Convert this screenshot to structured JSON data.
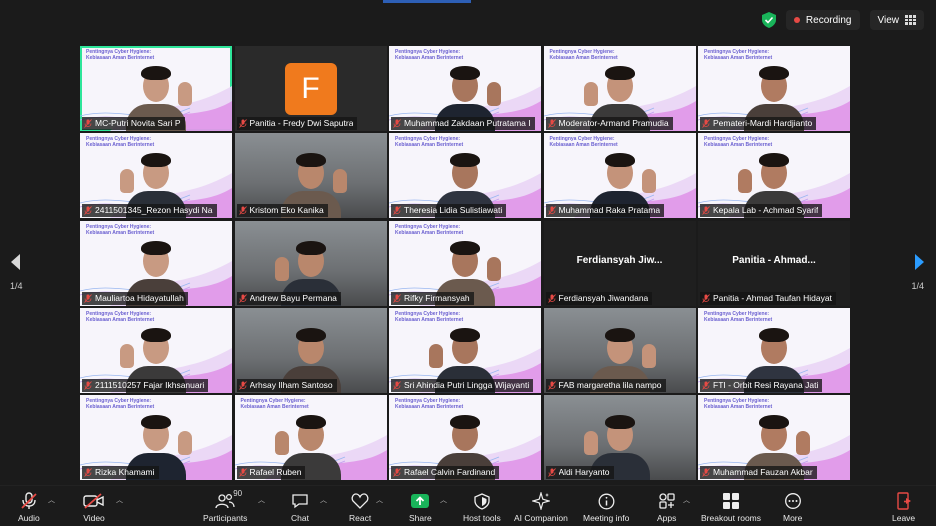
{
  "header": {
    "recording_label": "Recording",
    "view_label": "View"
  },
  "colors": {
    "background": "#1b1b1b",
    "active_speaker": "#2ee59a",
    "recording": "#e74a45",
    "share": "#19b45a",
    "avatar": "#f07a1d",
    "nav_arrow": "#2b9cff"
  },
  "slide": {
    "line1": "Pentingnya Cyber Hygiene:",
    "line2": "Kebiasaan Aman Berinternet"
  },
  "pagination": {
    "left": "1/4",
    "right": "1/4"
  },
  "tiles": [
    {
      "name": "MC-Putri Novita Sari P",
      "kind": "slide",
      "active": true
    },
    {
      "name": "Panitia - Fredy Dwi Saputra",
      "kind": "avatar",
      "avatar_letter": "F"
    },
    {
      "name": "Muhammad Zakdaan Putratama I",
      "kind": "slide"
    },
    {
      "name": "Moderator-Armand Pramudia",
      "kind": "slide"
    },
    {
      "name": "Pemateri-Mardi Hardjianto",
      "kind": "slide"
    },
    {
      "name": "2411501345_Rezon Hasydi Na",
      "kind": "slide"
    },
    {
      "name": "Kristom Eko Kanika",
      "kind": "room"
    },
    {
      "name": "Theresia Lidia Sulistiawati",
      "kind": "slide"
    },
    {
      "name": "Muhammad Raka Pratama",
      "kind": "slide"
    },
    {
      "name": "Kepala Lab - Achmad Syarif",
      "kind": "slide"
    },
    {
      "name": "Mauliartoa Hidayatullah",
      "kind": "slide"
    },
    {
      "name": "Andrew Bayu Permana",
      "kind": "room"
    },
    {
      "name": "Rifky Firmansyah",
      "kind": "slide"
    },
    {
      "name": "Ferdiansyah Jiwandana",
      "kind": "off",
      "display_name": "Ferdiansyah  Jiw..."
    },
    {
      "name": "Panitia - Ahmad Taufan Hidayat",
      "kind": "off",
      "display_name": "Panitia  -  Ahmad..."
    },
    {
      "name": "2111510257 Fajar Ikhsanuari",
      "kind": "slide"
    },
    {
      "name": "Arhsay Ilham Santoso",
      "kind": "room"
    },
    {
      "name": "Sri Ahindia Putri Lingga Wijayanti",
      "kind": "slide"
    },
    {
      "name": "FAB margaretha lila nampo",
      "kind": "room"
    },
    {
      "name": "FTI - Orbit Resi Rayana Jati",
      "kind": "slide"
    },
    {
      "name": "Rizka Khamami",
      "kind": "slide"
    },
    {
      "name": "Rafael Ruben",
      "kind": "slide"
    },
    {
      "name": "Rafael Calvin Fardinand",
      "kind": "slide"
    },
    {
      "name": "Aldi Haryanto",
      "kind": "room"
    },
    {
      "name": "Muhammad Fauzan Akbar",
      "kind": "slide"
    }
  ],
  "toolbar": {
    "audio": "Audio",
    "video": "Video",
    "participants": "Participants",
    "participants_count": "90",
    "chat": "Chat",
    "react": "React",
    "share": "Share",
    "host_tools": "Host tools",
    "ai_companion": "AI Companion",
    "meeting_info": "Meeting info",
    "apps": "Apps",
    "breakout_rooms": "Breakout rooms",
    "more": "More",
    "leave": "Leave"
  }
}
